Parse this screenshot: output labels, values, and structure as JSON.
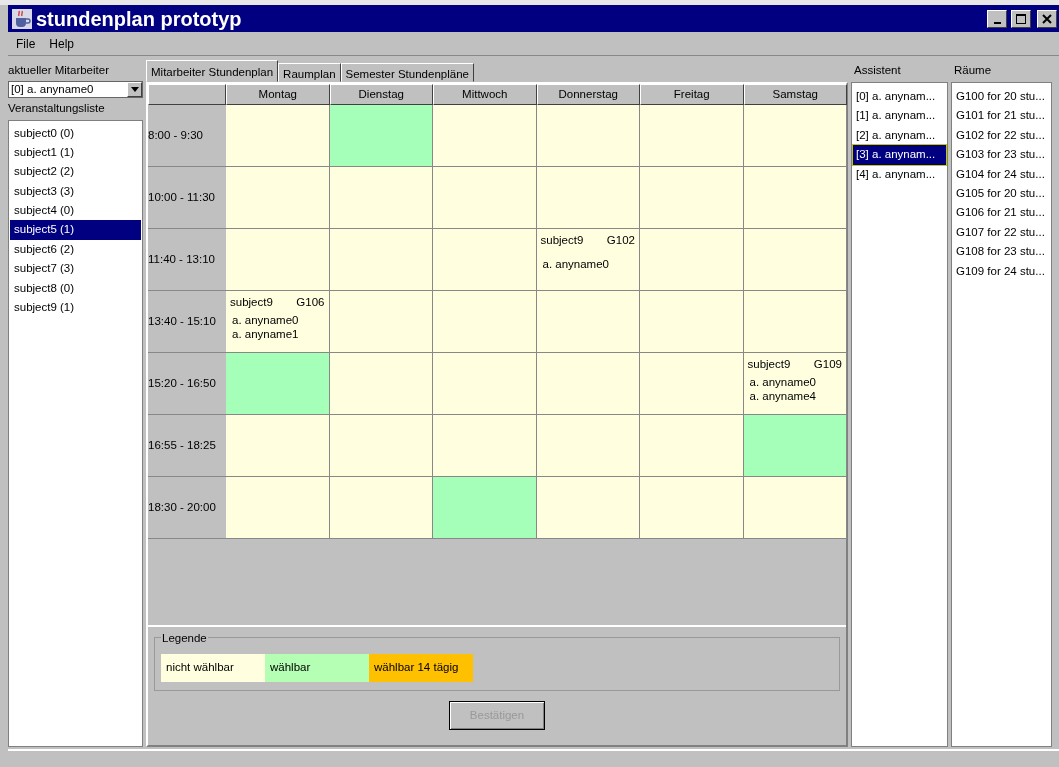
{
  "window": {
    "title": "stundenplan prototyp"
  },
  "menu": [
    "File",
    "Help"
  ],
  "left": {
    "employee_label": "aktueller Mitarbeiter",
    "employee_value": "[0]  a. anyname0",
    "list_label": "Veranstaltungsliste",
    "items": [
      {
        "label": "subject0 (0)",
        "selected": false
      },
      {
        "label": "subject1 (1)",
        "selected": false
      },
      {
        "label": "subject2 (2)",
        "selected": false
      },
      {
        "label": "subject3 (3)",
        "selected": false
      },
      {
        "label": "subject4 (0)",
        "selected": false
      },
      {
        "label": "subject5 (1)",
        "selected": true
      },
      {
        "label": "subject6 (2)",
        "selected": false
      },
      {
        "label": "subject7 (3)",
        "selected": false
      },
      {
        "label": "subject8 (0)",
        "selected": false
      },
      {
        "label": "subject9 (1)",
        "selected": false
      }
    ]
  },
  "tabs": [
    {
      "label": "Mitarbeiter Stundenplan",
      "selected": true
    },
    {
      "label": "Raumplan",
      "selected": false
    },
    {
      "label": "Semester Stundenpläne",
      "selected": false
    }
  ],
  "timetable": {
    "days": [
      "Montag",
      "Dienstag",
      "Mittwoch",
      "Donnerstag",
      "Freitag",
      "Samstag"
    ],
    "rows": [
      {
        "time": "8:00 - 9:30",
        "cells": [
          {
            "kind": "blocked"
          },
          {
            "kind": "selectable"
          },
          {
            "kind": "blocked"
          },
          {
            "kind": "blocked"
          },
          {
            "kind": "blocked"
          },
          {
            "kind": "blocked"
          }
        ]
      },
      {
        "time": "10:00 - 11:30",
        "cells": [
          {
            "kind": "blocked"
          },
          {
            "kind": "blocked"
          },
          {
            "kind": "blocked"
          },
          {
            "kind": "blocked"
          },
          {
            "kind": "blocked"
          },
          {
            "kind": "blocked"
          }
        ]
      },
      {
        "time": "11:40 - 13:10",
        "cells": [
          {
            "kind": "blocked"
          },
          {
            "kind": "blocked"
          },
          {
            "kind": "blocked"
          },
          {
            "kind": "blocked",
            "subject": "subject9",
            "room": "G102",
            "people": [
              "a. anyname0"
            ]
          },
          {
            "kind": "blocked"
          },
          {
            "kind": "blocked"
          }
        ]
      },
      {
        "time": "13:40 - 15:10",
        "cells": [
          {
            "kind": "blocked",
            "subject": "subject9",
            "room": "G106",
            "people": [
              "a. anyname0",
              "a. anyname1"
            ]
          },
          {
            "kind": "blocked"
          },
          {
            "kind": "blocked"
          },
          {
            "kind": "blocked"
          },
          {
            "kind": "blocked"
          },
          {
            "kind": "blocked"
          }
        ]
      },
      {
        "time": "15:20 - 16:50",
        "cells": [
          {
            "kind": "selectable"
          },
          {
            "kind": "blocked"
          },
          {
            "kind": "blocked"
          },
          {
            "kind": "blocked"
          },
          {
            "kind": "blocked"
          },
          {
            "kind": "blocked",
            "subject": "subject9",
            "room": "G109",
            "people": [
              "a. anyname0",
              "a. anyname4"
            ]
          }
        ]
      },
      {
        "time": "16:55 - 18:25",
        "cells": [
          {
            "kind": "blocked"
          },
          {
            "kind": "blocked"
          },
          {
            "kind": "blocked"
          },
          {
            "kind": "blocked"
          },
          {
            "kind": "blocked"
          },
          {
            "kind": "selectable"
          }
        ]
      },
      {
        "time": "18:30 - 20:00",
        "cells": [
          {
            "kind": "blocked"
          },
          {
            "kind": "blocked"
          },
          {
            "kind": "selectable"
          },
          {
            "kind": "blocked"
          },
          {
            "kind": "blocked"
          },
          {
            "kind": "blocked"
          }
        ]
      }
    ]
  },
  "legend": {
    "title": "Legende",
    "items": [
      {
        "label": "nicht wählbar",
        "color": "#ffffe0"
      },
      {
        "label": "wählbar",
        "color": "#b4ffb4"
      },
      {
        "label": "wählbar 14 tägig",
        "color": "#ffc000"
      }
    ]
  },
  "confirm_button": {
    "label": "Bestätigen",
    "disabled": true
  },
  "assistants": {
    "heading": "Assistent",
    "items": [
      {
        "label": "[0]  a. anynam...",
        "selected": false
      },
      {
        "label": "[1]  a. anynam...",
        "selected": false
      },
      {
        "label": "[2]  a. anynam...",
        "selected": false
      },
      {
        "label": "[3]  a. anynam...",
        "selected": true
      },
      {
        "label": "[4]  a. anynam...",
        "selected": false
      }
    ]
  },
  "rooms": {
    "heading": "Räume",
    "items": [
      "G100 for 20 stu...",
      "G101 for 21 stu...",
      "G102 for 22 stu...",
      "G103 for 23 stu...",
      "G104 for 24 stu...",
      "G105 for 20 stu...",
      "G106 for 21 stu...",
      "G107 for 22 stu...",
      "G108 for 23 stu...",
      "G109 for 24 stu..."
    ]
  }
}
